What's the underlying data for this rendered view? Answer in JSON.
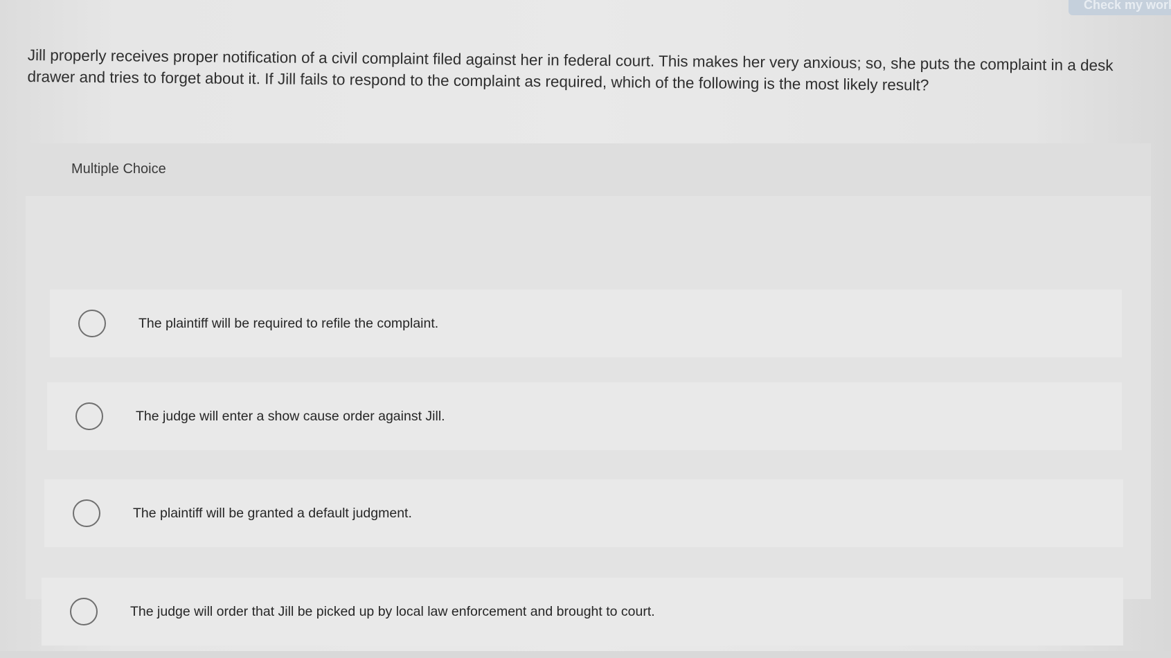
{
  "header": {
    "action_button_label": "Check my work"
  },
  "question": {
    "text": "Jill properly receives proper notification of a civil complaint filed against her in federal court. This makes her very anxious; so, she puts the complaint in a desk drawer and tries to forget about it. If Jill fails to respond to the complaint as required, which of the following is the most likely result?"
  },
  "answer_panel": {
    "label": "Multiple Choice",
    "options": [
      {
        "text": "The plaintiff will be required to refile the complaint."
      },
      {
        "text": "The judge will enter a show cause order against Jill."
      },
      {
        "text": "The plaintiff will be granted a default judgment."
      },
      {
        "text": "The judge will order that Jill be picked up by local law enforcement and brought to court."
      }
    ]
  },
  "colors": {
    "page_background": "#e6e6e6",
    "panel_background": "#e0e0e0",
    "option_background": "#e9e9e9",
    "radio_border": "#6f6f6f",
    "action_button": "#c5d0dc"
  }
}
